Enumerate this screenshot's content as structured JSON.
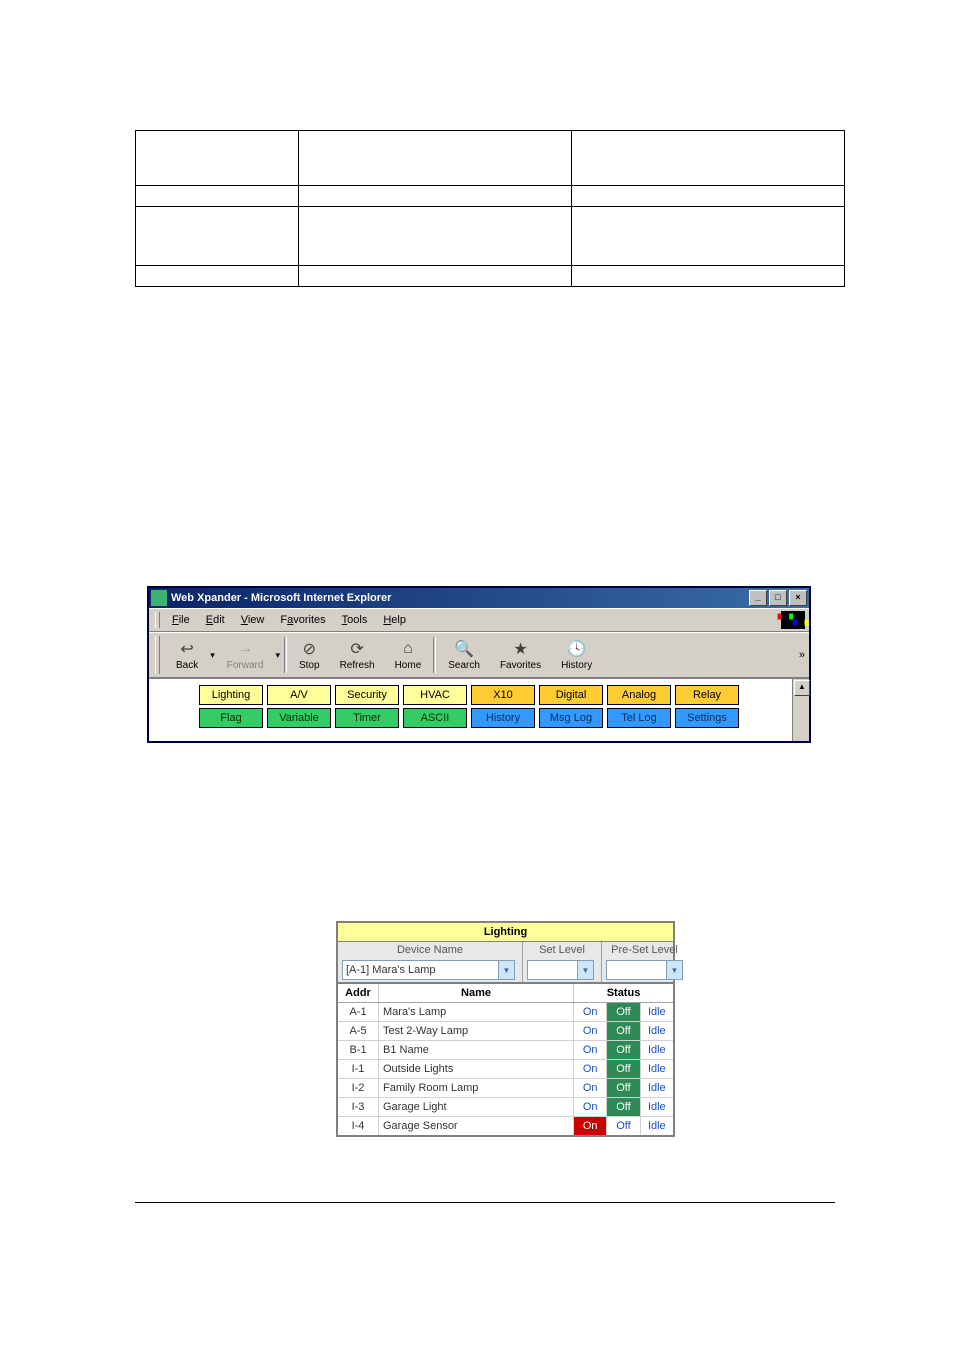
{
  "empty_table": {
    "rows": 4,
    "cols": 3
  },
  "browser": {
    "title": "Web Xpander - Microsoft Internet Explorer",
    "win_buttons": {
      "min": "_",
      "max": "□",
      "close": "×"
    },
    "menus": [
      {
        "label": "File",
        "u": "F"
      },
      {
        "label": "Edit",
        "u": "E"
      },
      {
        "label": "View",
        "u": "V"
      },
      {
        "label": "Favorites",
        "u": "a"
      },
      {
        "label": "Tools",
        "u": "T"
      },
      {
        "label": "Help",
        "u": "H"
      }
    ],
    "toolbar": [
      {
        "name": "back",
        "label": "Back",
        "enabled": true,
        "glyph": "↩"
      },
      {
        "name": "forward",
        "label": "Forward",
        "enabled": false,
        "glyph": "→"
      },
      {
        "name": "stop",
        "label": "Stop",
        "enabled": true,
        "glyph": "⊘"
      },
      {
        "name": "refresh",
        "label": "Refresh",
        "enabled": true,
        "glyph": "⟳"
      },
      {
        "name": "home",
        "label": "Home",
        "enabled": true,
        "glyph": "⌂"
      },
      {
        "name": "search",
        "label": "Search",
        "enabled": true,
        "glyph": "🔍"
      },
      {
        "name": "favorites",
        "label": "Favorites",
        "enabled": true,
        "glyph": "★"
      },
      {
        "name": "history",
        "label": "History",
        "enabled": true,
        "glyph": "🕓"
      }
    ],
    "more": "»",
    "nav_rows": [
      [
        {
          "label": "Lighting",
          "cls": "nb-yellow"
        },
        {
          "label": "A/V",
          "cls": "nb-yellow"
        },
        {
          "label": "Security",
          "cls": "nb-yellow"
        },
        {
          "label": "HVAC",
          "cls": "nb-yellow"
        },
        {
          "label": "X10",
          "cls": "nb-orange"
        },
        {
          "label": "Digital",
          "cls": "nb-orange"
        },
        {
          "label": "Analog",
          "cls": "nb-orange"
        },
        {
          "label": "Relay",
          "cls": "nb-orange"
        }
      ],
      [
        {
          "label": "Flag",
          "cls": "nb-green"
        },
        {
          "label": "Variable",
          "cls": "nb-green"
        },
        {
          "label": "Timer",
          "cls": "nb-green"
        },
        {
          "label": "ASCII",
          "cls": "nb-green"
        },
        {
          "label": "History",
          "cls": "nb-blue"
        },
        {
          "label": "Msg Log",
          "cls": "nb-blue"
        },
        {
          "label": "Tel Log",
          "cls": "nb-blue"
        },
        {
          "label": "Settings",
          "cls": "nb-blue"
        }
      ]
    ]
  },
  "lighting": {
    "title": "Lighting",
    "controls": {
      "device_label": "Device Name",
      "device_value": "[A-1] Mara's Lamp",
      "set_level_label": "Set Level",
      "set_level_value": "",
      "preset_label": "Pre-Set Level",
      "preset_value": ""
    },
    "head": {
      "addr": "Addr",
      "name": "Name",
      "status": "Status"
    },
    "rows": [
      {
        "addr": "A-1",
        "name": "Mara's Lamp",
        "on": "On",
        "off": "Off",
        "idle": "Idle",
        "active": "off"
      },
      {
        "addr": "A-5",
        "name": "Test 2-Way Lamp",
        "on": "On",
        "off": "Off",
        "idle": "Idle",
        "active": "off"
      },
      {
        "addr": "B-1",
        "name": "B1 Name",
        "on": "On",
        "off": "Off",
        "idle": "Idle",
        "active": "off"
      },
      {
        "addr": "I-1",
        "name": "Outside Lights",
        "on": "On",
        "off": "Off",
        "idle": "Idle",
        "active": "off"
      },
      {
        "addr": "I-2",
        "name": "Family Room Lamp",
        "on": "On",
        "off": "Off",
        "idle": "Idle",
        "active": "off"
      },
      {
        "addr": "I-3",
        "name": "Garage Light",
        "on": "On",
        "off": "Off",
        "idle": "Idle",
        "active": "off"
      },
      {
        "addr": "I-4",
        "name": "Garage Sensor",
        "on": "On",
        "off": "Off",
        "idle": "Idle",
        "active": "on"
      }
    ]
  }
}
